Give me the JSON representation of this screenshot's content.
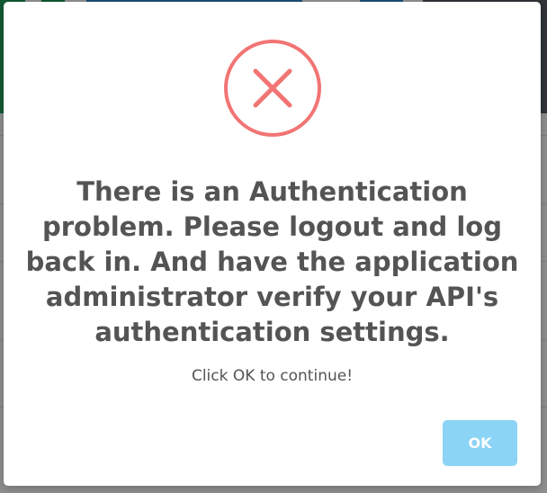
{
  "dialog": {
    "icon": "error-x-icon",
    "title": "There is an Authentication problem. Please logout and log back in. And have the application administrator verify your API's authentication settings.",
    "message": "Click OK to continue!",
    "ok_label": "OK"
  },
  "colors": {
    "error_red": "#f27474",
    "ok_button": "#8cd4f5",
    "text": "#545454"
  }
}
